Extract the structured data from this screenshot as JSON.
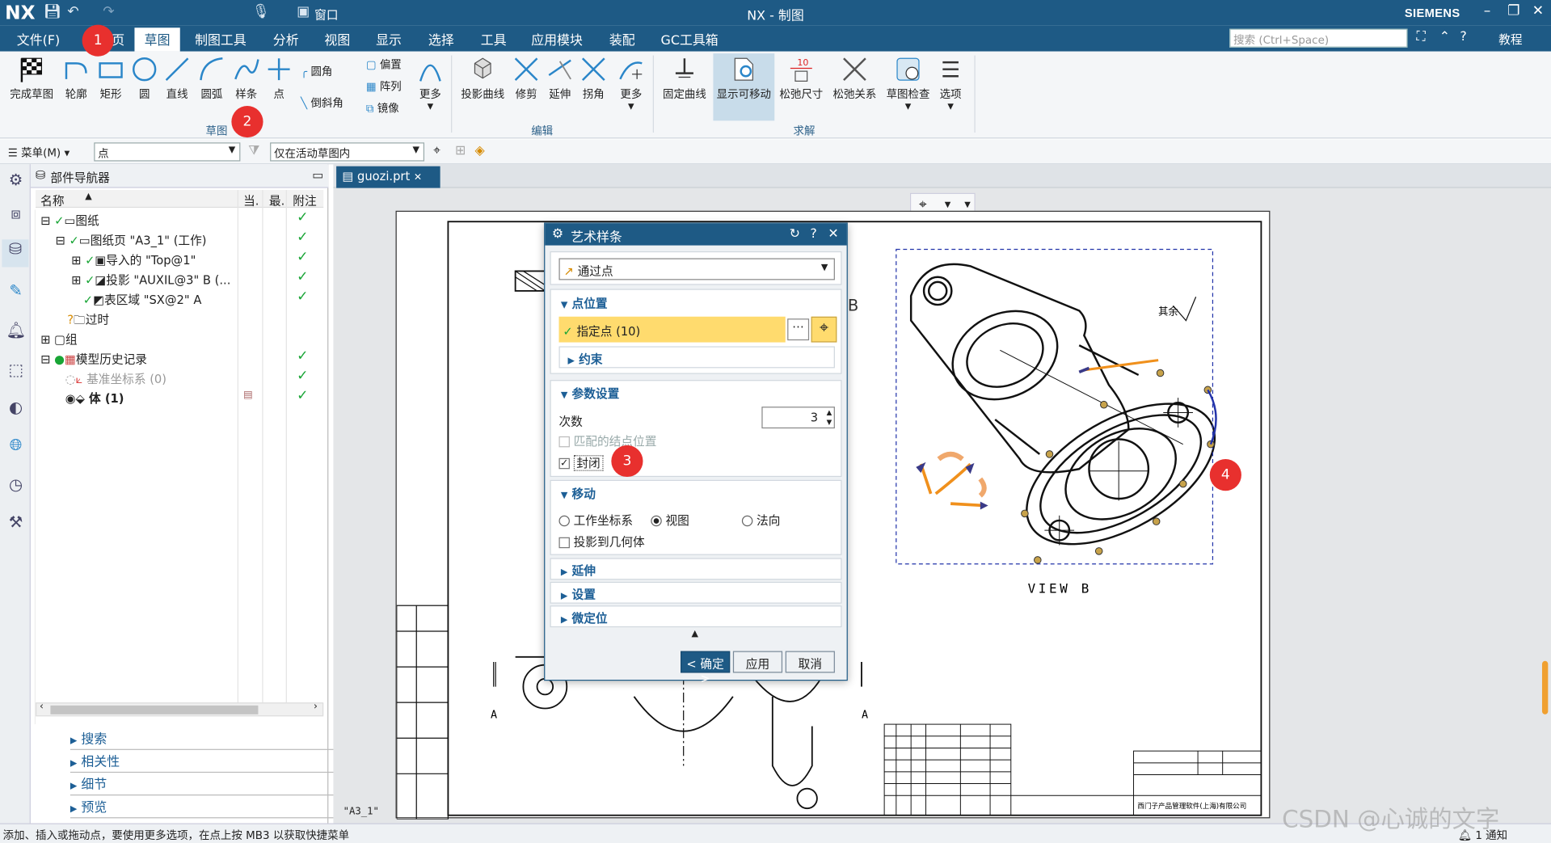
{
  "window": {
    "logo": "NX",
    "title": "NX - 制图",
    "brand": "SIEMENS",
    "window_menu": "窗口"
  },
  "menubar": {
    "items": [
      "文件(F)",
      "主页",
      "草图",
      "制图工具",
      "分析",
      "视图",
      "显示",
      "选择",
      "工具",
      "应用模块",
      "装配",
      "GC工具箱"
    ],
    "active": "草图",
    "search_placeholder": "搜索 (Ctrl+Space)",
    "help": "教程"
  },
  "ribbon": {
    "sketch_tools": [
      "完成草图",
      "轮廓",
      "矩形",
      "圆",
      "直线",
      "圆弧",
      "样条",
      "点"
    ],
    "small_tools": [
      "圆角",
      "倒斜角",
      "偏置",
      "阵列",
      "镜像"
    ],
    "more1": "更多",
    "group_sketch": "草图",
    "edit_tools": [
      "投影曲线",
      "修剪",
      "延伸",
      "拐角"
    ],
    "more2": "更多",
    "group_edit": "编辑",
    "solve_tools": [
      "固定曲线",
      "显示可移动",
      "松弛尺寸",
      "松弛关系",
      "草图检查",
      "选项"
    ],
    "group_solve": "求解"
  },
  "selbar": {
    "menu": "菜单(M)",
    "filter": "点",
    "scope": "仅在活动草图内"
  },
  "navigator": {
    "title": "部件导航器",
    "columns": [
      "名称",
      "当.",
      "最.",
      "附注"
    ],
    "rows": [
      {
        "label": "图纸",
        "indent": 0,
        "check": true
      },
      {
        "label": "图纸页 \"A3_1\" (工作)",
        "indent": 1,
        "check": true
      },
      {
        "label": "导入的 \"Top@1\"",
        "indent": 2,
        "check": true
      },
      {
        "label": "投影 \"AUXIL@3\" B (...",
        "indent": 2,
        "check": true
      },
      {
        "label": "表区域 \"SX@2\" A",
        "indent": 2,
        "check": true
      },
      {
        "label": "过时",
        "indent": 1,
        "check": false
      },
      {
        "label": "组",
        "indent": 0,
        "check": false
      },
      {
        "label": "模型历史记录",
        "indent": 0,
        "check": true
      },
      {
        "label": "基准坐标系 (0)",
        "indent": 1,
        "check": true
      },
      {
        "label": "体 (1)",
        "indent": 1,
        "check": true
      }
    ],
    "panels": [
      "搜索",
      "相关性",
      "细节",
      "预览"
    ]
  },
  "document_tab": "guozi.prt",
  "drawing": {
    "view_label": "VIEW B",
    "section_a": "A",
    "sheet_name": "\"A3_1\"",
    "surface_note": "其余",
    "company": "西门子产品管理软件(上海)有限公司"
  },
  "dialog": {
    "title": "艺术样条",
    "type": "通过点",
    "section_points": "点位置",
    "specify_points": "指定点 (10)",
    "constraint": "约束",
    "section_params": "参数设置",
    "degree_label": "次数",
    "degree_value": "3",
    "match_knots": "匹配的结点位置",
    "closed": "封闭",
    "section_move": "移动",
    "move_options": [
      "工作坐标系",
      "视图",
      "法向"
    ],
    "project_geom": "投影到几何体",
    "extend": "延伸",
    "settings": "设置",
    "fine_pos": "微定位",
    "ok": "< 确定 >",
    "apply": "应用",
    "cancel": "取消"
  },
  "badges": [
    "1",
    "2",
    "3",
    "4"
  ],
  "status": {
    "message": "添加、插入或拖动点，要使用更多选项，在点上按 MB3 以获取快捷菜单",
    "notify": "1 通知"
  },
  "watermark": "CSDN @心诚的文字"
}
